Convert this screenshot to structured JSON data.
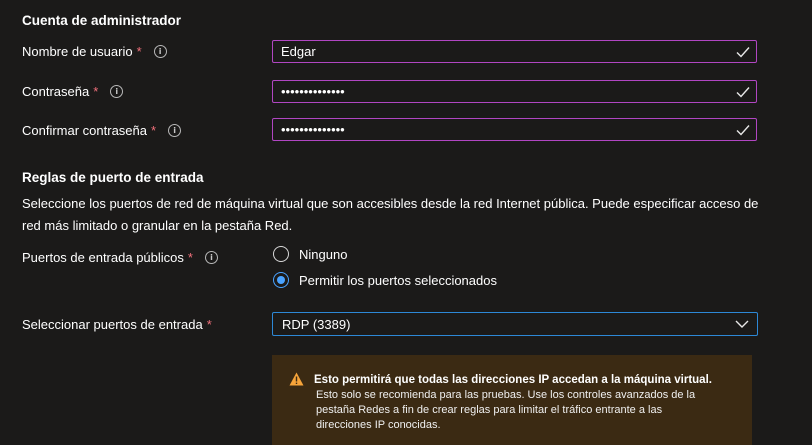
{
  "admin": {
    "title": "Cuenta de administrador",
    "username": {
      "label": "Nombre de usuario",
      "required": "*",
      "value": "Edgar"
    },
    "password": {
      "label": "Contraseña",
      "required": "*",
      "value": "••••••••••••••"
    },
    "confirm": {
      "label": "Confirmar contraseña",
      "required": "*",
      "value": "••••••••••••••"
    }
  },
  "ports": {
    "title": "Reglas de puerto de entrada",
    "description_line1": "Seleccione los puertos de red de máquina virtual que son accesibles desde la red Internet pública. Puede especificar acceso de",
    "description_line2": "red más limitado o granular en la pestaña Red.",
    "public_ports": {
      "label": "Puertos de entrada públicos",
      "required": "*",
      "options": [
        "Ninguno",
        "Permitir los puertos seleccionados"
      ],
      "selected": "Permitir los puertos seleccionados"
    },
    "select_ports": {
      "label": "Seleccionar puertos de entrada",
      "required": "*",
      "value": "RDP (3389)"
    }
  },
  "warning": {
    "title": "Esto permitirá que todas las direcciones IP accedan a la máquina virtual.",
    "line1": "Esto solo se recomienda para las pruebas.  Use los controles avanzados de la",
    "line2": "pestaña Redes a fin de crear reglas para limitar el tráfico entrante a las",
    "line3": "direcciones IP conocidas."
  },
  "colors": {
    "background": "#1b1a19",
    "field_border": "#b146c2",
    "focus_border": "#2d88d6",
    "required": "#f1707b",
    "warning_bg": "#3b2a13",
    "warning_icon": "#f7a43a"
  }
}
